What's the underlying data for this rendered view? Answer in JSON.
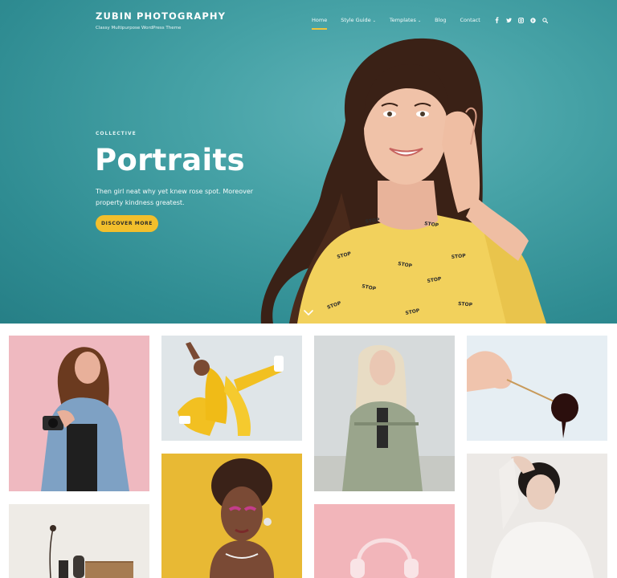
{
  "site": {
    "title": "ZUBIN PHOTOGRAPHY",
    "tagline": "Classy Multipurpose WordPress Theme"
  },
  "nav": {
    "items": [
      {
        "label": "Home",
        "active": true
      },
      {
        "label": "Style Guide",
        "has_dropdown": true
      },
      {
        "label": "Templates",
        "has_dropdown": true
      },
      {
        "label": "Blog"
      },
      {
        "label": "Contact"
      }
    ],
    "dropdown_glyph": "⌄",
    "icons": [
      "facebook-icon",
      "twitter-icon",
      "instagram-icon",
      "pinterest-icon",
      "search-icon"
    ]
  },
  "hero": {
    "eyebrow": "COLLECTIVE",
    "title": "Portraits",
    "description": "Then girl neat why yet knew rose spot. Moreover property kindness greatest.",
    "cta_label": "DISCOVER MORE",
    "shirt_print": "STOP"
  },
  "colors": {
    "hero_teal": "#3d9aa0",
    "accent_yellow": "#f2bf2c",
    "text_white": "#ffffff"
  },
  "gallery": {
    "tiles": [
      {
        "name": "woman-with-camera-pink-wall"
      },
      {
        "name": "dancer-yellow-outfit"
      },
      {
        "name": "blonde-woman-trench-coat"
      },
      {
        "name": "hand-dipping-chocolate"
      },
      {
        "name": "woman-yellow-backdrop"
      },
      {
        "name": "woman-white-blouse"
      },
      {
        "name": "still-life-vase-chair"
      },
      {
        "name": "headphones-pink-background"
      }
    ]
  }
}
